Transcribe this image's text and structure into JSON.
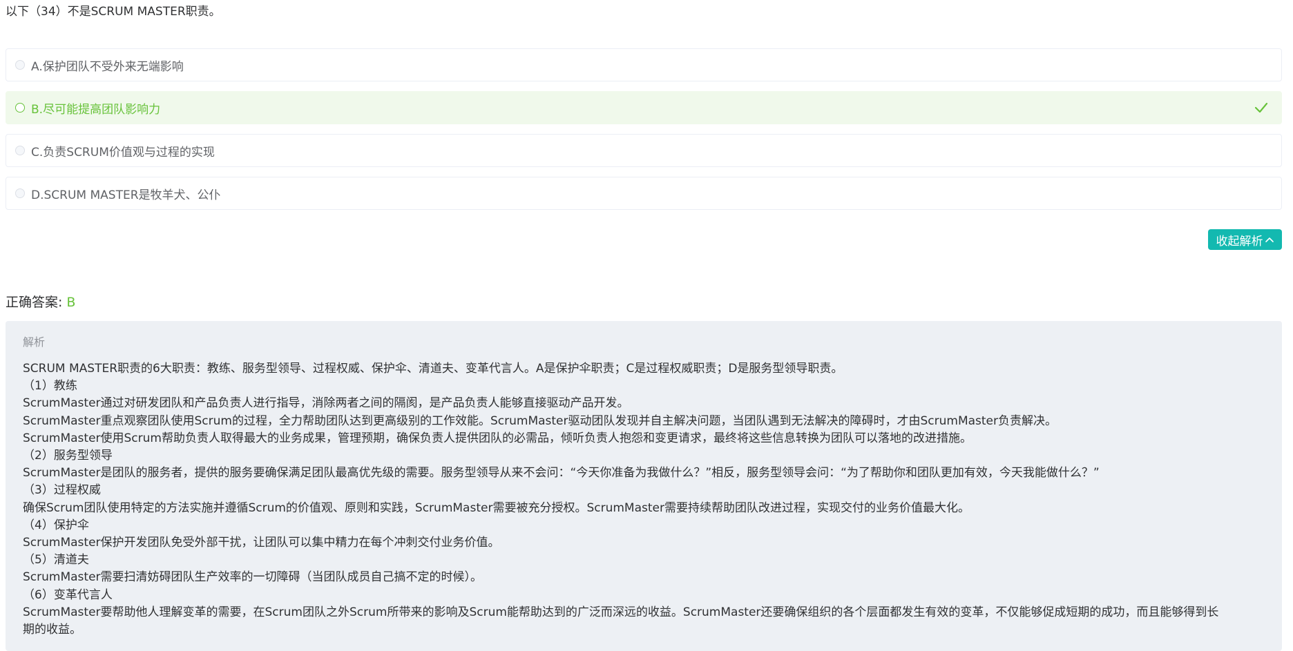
{
  "question": {
    "text": "以下（34）不是SCRUM MASTER职责。"
  },
  "options": [
    {
      "label": "A.保护团队不受外来无端影响",
      "correct": false
    },
    {
      "label": "B.尽可能提高团队影响力",
      "correct": true
    },
    {
      "label": "C.负责SCRUM价值观与过程的实现",
      "correct": false
    },
    {
      "label": "D.SCRUM MASTER是牧羊犬、公仆",
      "correct": false
    }
  ],
  "toggle_button": {
    "label": "收起解析",
    "icon": "chevron-up-icon"
  },
  "answer": {
    "label": "正确答案:",
    "value": "B"
  },
  "analysis": {
    "title": "解析",
    "lines": [
      "SCRUM MASTER职责的6大职责：教练、服务型领导、过程权威、保护伞、清道夫、变革代言人。A是保护伞职责；C是过程权威职责；D是服务型领导职责。",
      "（1）教练",
      "ScrumMaster通过对研发团队和产品负责人进行指导，消除两者之间的隔阂，是产品负责人能够直接驱动产品开发。",
      "ScrumMaster重点观察团队使用Scrum的过程，全力帮助团队达到更高级别的工作效能。ScrumMaster驱动团队发现并自主解决问题，当团队遇到无法解决的障碍时，才由ScrumMaster负责解决。",
      "ScrumMaster使用Scrum帮助负责人取得最大的业务成果，管理预期，确保负责人提供团队的必需品，倾听负责人抱怨和变更请求，最终将这些信息转换为团队可以落地的改进措施。",
      "（2）服务型领导",
      "ScrumMaster是团队的服务者，提供的服务要确保满足团队最高优先级的需要。服务型领导从来不会问：“今天你准备为我做什么？”相反，服务型领导会问：“为了帮助你和团队更加有效，今天我能做什么？”",
      "（3）过程权威",
      "确保Scrum团队使用特定的方法实施并遵循Scrum的价值观、原则和实践，ScrumMaster需要被充分授权。ScrumMaster需要持续帮助团队改进过程，实现交付的业务价值最大化。",
      "（4）保护伞",
      "ScrumMaster保护开发团队免受外部干扰，让团队可以集中精力在每个冲刺交付业务价值。",
      "（5）清道夫",
      "ScrumMaster需要扫清妨碍团队生产效率的一切障碍（当团队成员自己搞不定的时候）。",
      "（6）变革代言人",
      "ScrumMaster要帮助他人理解变革的需要，在Scrum团队之外Scrum所带来的影响及Scrum能帮助达到的广泛而深远的收益。ScrumMaster还要确保组织的各个层面都发生有效的变革，不仅能够促成短期的成功，而且能够得到长",
      "期的收益。"
    ]
  },
  "colors": {
    "correct_green": "#67c23a",
    "correct_bg": "#f0f9eb",
    "button_teal": "#13b9b0",
    "analysis_bg": "#edf0f4"
  }
}
